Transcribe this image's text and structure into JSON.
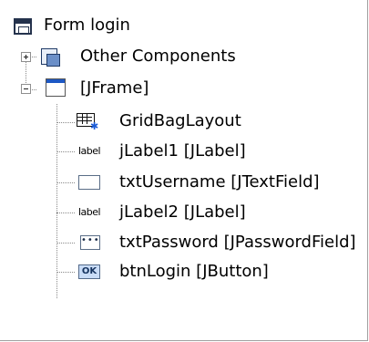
{
  "tree": {
    "root": {
      "label": "Form login",
      "icon": "form-icon"
    },
    "other_components": {
      "label": "Other Components",
      "icon": "components-icon",
      "expanded": false
    },
    "frame": {
      "label": "[JFrame]",
      "icon": "jframe-icon",
      "expanded": true
    },
    "children": [
      {
        "label": "GridBagLayout",
        "icon": "gridbag-layout-icon"
      },
      {
        "label": "jLabel1 [JLabel]",
        "icon": "label-icon",
        "icon_text": "label"
      },
      {
        "label": "txtUsername [JTextField]",
        "icon": "textfield-icon"
      },
      {
        "label": "jLabel2 [JLabel]",
        "icon": "label-icon",
        "icon_text": "label"
      },
      {
        "label": "txtPassword [JPasswordField]",
        "icon": "passwordfield-icon",
        "icon_text": "•••"
      },
      {
        "label": "btnLogin [JButton]",
        "icon": "button-icon",
        "icon_text": "OK"
      }
    ]
  },
  "colors": {
    "frame_title": "#1d58c4",
    "tree_lines": "#8a8a8a",
    "button_fill": "#c9dcf7"
  }
}
